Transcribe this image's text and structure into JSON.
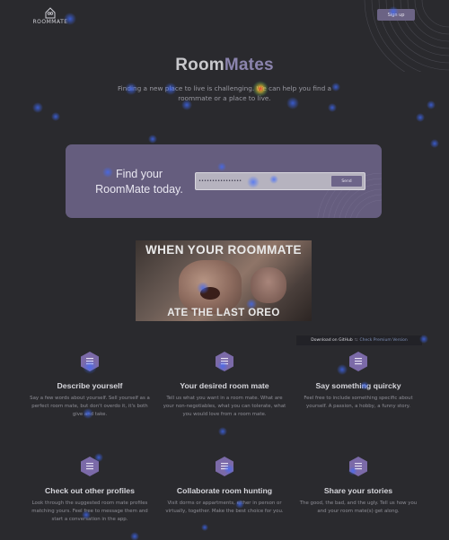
{
  "header": {
    "logo_text": "ROOMMATE",
    "login_label": "Sign up"
  },
  "hero": {
    "title_part1": "Room",
    "title_part2": "Mates",
    "subtitle": "Finding a new place to live is challenging. We can help you find a roommate or a place to live."
  },
  "banner": {
    "title_line1": "Find your",
    "title_line2": "RoomMate today.",
    "email_value": "••••••••••••••••",
    "submit_label": "Send"
  },
  "meme": {
    "top_text": "WHEN YOUR ROOMMATE",
    "bottom_text": "ATE THE LAST OREO"
  },
  "github_bar": {
    "download_label": "Download on GitHub",
    "separator": "⇆",
    "check_label": "Check Premium Version"
  },
  "features": [
    {
      "title": "Describe yourself",
      "text": "Say a few words about yourself. Sell yourself as a perfect room mate, but don't overdo it, it's both give and take."
    },
    {
      "title": "Your desired room mate",
      "text": "Tell us what you want in a room mate. What are your non-negotiables, what you can tolerate, what you would love from a room mate."
    },
    {
      "title": "Say something quircky",
      "text": "Feel free to include something specific about yourself. A passion, a hobby, a funny story."
    },
    {
      "title": "Check out other profiles",
      "text": "Look through the suggested room mate profiles matching yours. Feel free to message them and start a conversation in the app."
    },
    {
      "title": "Collaborate room hunting",
      "text": "Visit dorms or appartments, either in person or virtually, together. Make the best choice for you."
    },
    {
      "title": "Share your stories",
      "text": "The good, the bad, and the ugly. Tell us how you and your room mate(s) get along."
    }
  ],
  "colors": {
    "background": "#2a2a2e",
    "accent": "#8b84ad",
    "banner": "#655d7e",
    "icon": "#7b6aa8"
  },
  "icons": {
    "logo": "roommate-logo-icon",
    "feature": "document-list-icon"
  }
}
